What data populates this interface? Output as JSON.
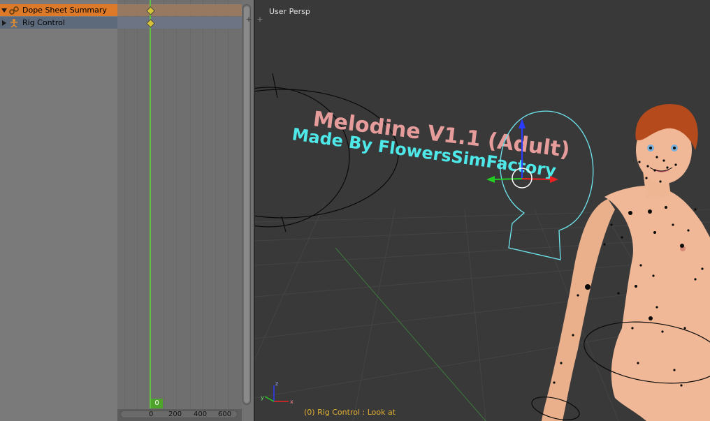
{
  "dopesheet": {
    "channels": [
      {
        "label": "Dope Sheet Summary",
        "icon": "dopesheet-summary-icon"
      },
      {
        "label": "Rig Control",
        "icon": "armature-icon"
      }
    ],
    "current_frame": "0",
    "ruler_ticks": [
      "0",
      "200",
      "400",
      "600"
    ]
  },
  "viewport": {
    "view_label": "User Persp",
    "scene_text": {
      "line1": "Melodine V1.1 (Adult)",
      "line2": "Made By FlowersSimFactory"
    },
    "status": "(0) Rig Control : Look at",
    "axes": {
      "x": "x",
      "y": "y",
      "z": "z"
    }
  },
  "colors": {
    "summary_row": "#dc7a2a",
    "rig_row": "#5d6a7c",
    "playhead": "#60c040",
    "keyframe": "#d7c33a",
    "viewport_bg": "#393939",
    "text_pink": "#e79c9c",
    "text_cyan": "#4ee8e8",
    "status_text": "#e0b030"
  }
}
